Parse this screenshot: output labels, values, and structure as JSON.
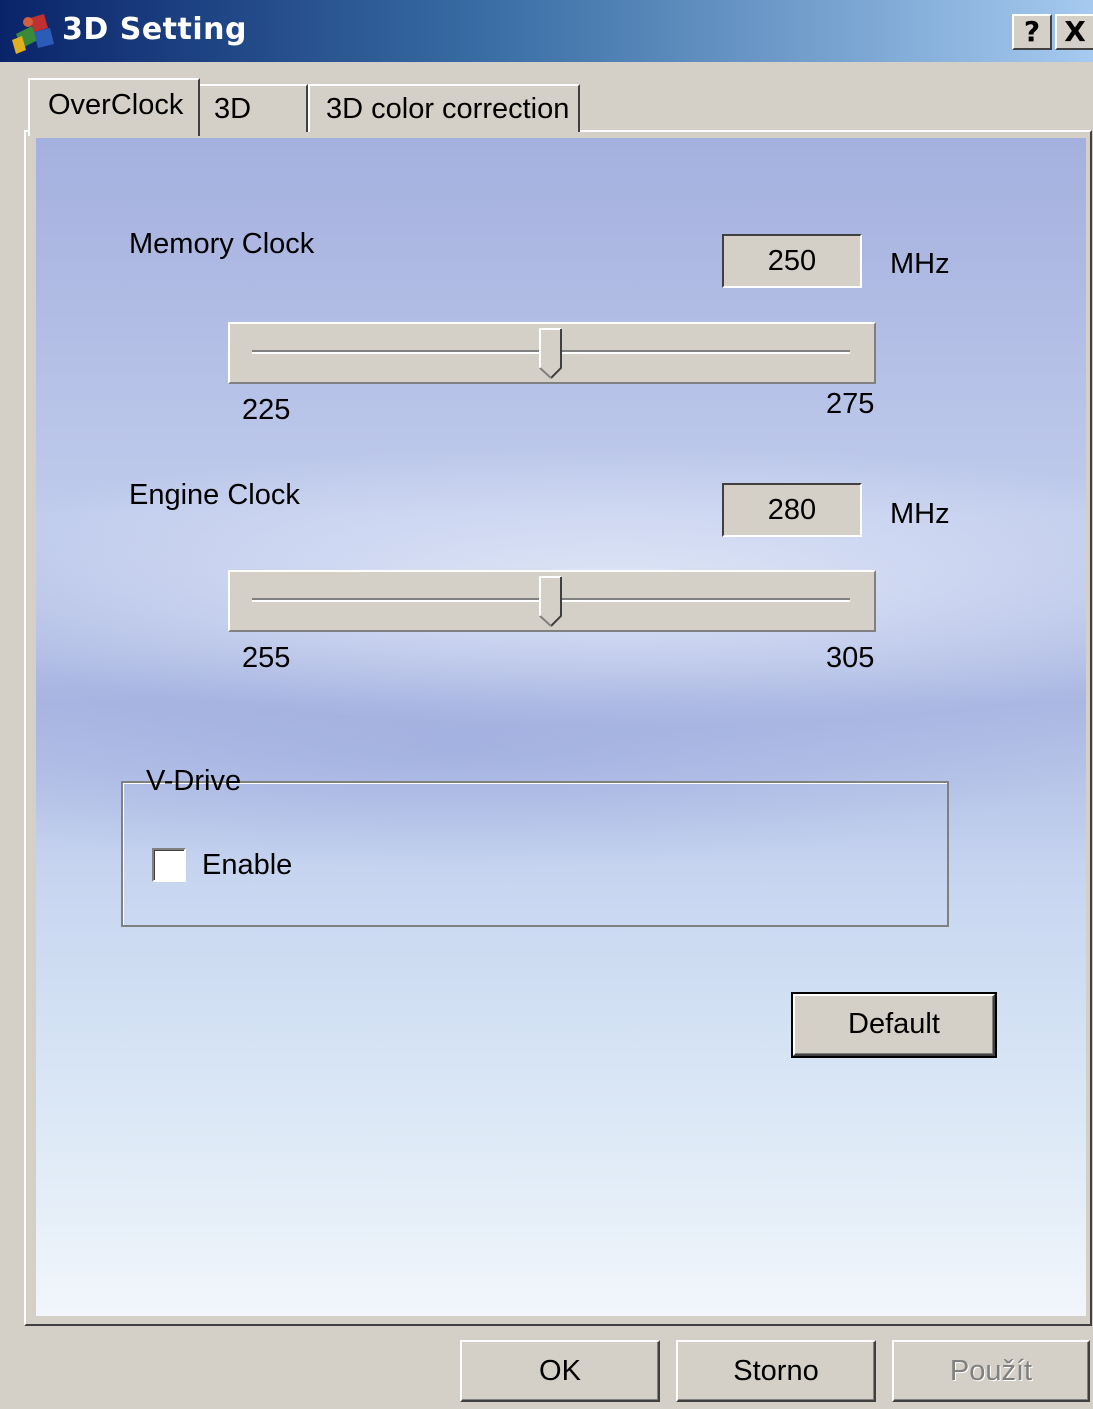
{
  "window": {
    "title": "3D Setting",
    "help_label": "?",
    "close_label": "X"
  },
  "tabs": [
    {
      "label": "OverClock",
      "selected": true
    },
    {
      "label": "3D",
      "selected": false
    },
    {
      "label": "3D color correction",
      "selected": false
    }
  ],
  "memory_clock": {
    "label": "Memory Clock",
    "value": "250",
    "unit": "MHz",
    "min_label": "225",
    "max_label": "275",
    "position_fraction": 0.5
  },
  "engine_clock": {
    "label": "Engine Clock",
    "value": "280",
    "unit": "MHz",
    "min_label": "255",
    "max_label": "305",
    "position_fraction": 0.5
  },
  "vdrive": {
    "group_label": "V-Drive",
    "enable_label": "Enable",
    "enable_checked": false
  },
  "buttons": {
    "default_label": "Default",
    "ok_label": "OK",
    "cancel_label": "Storno",
    "apply_label": "Použít"
  },
  "colors": {
    "titlebar_start": "#0a246a",
    "titlebar_end": "#a6caf0",
    "face": "#d4d0c8",
    "disabled_text": "#808080"
  }
}
